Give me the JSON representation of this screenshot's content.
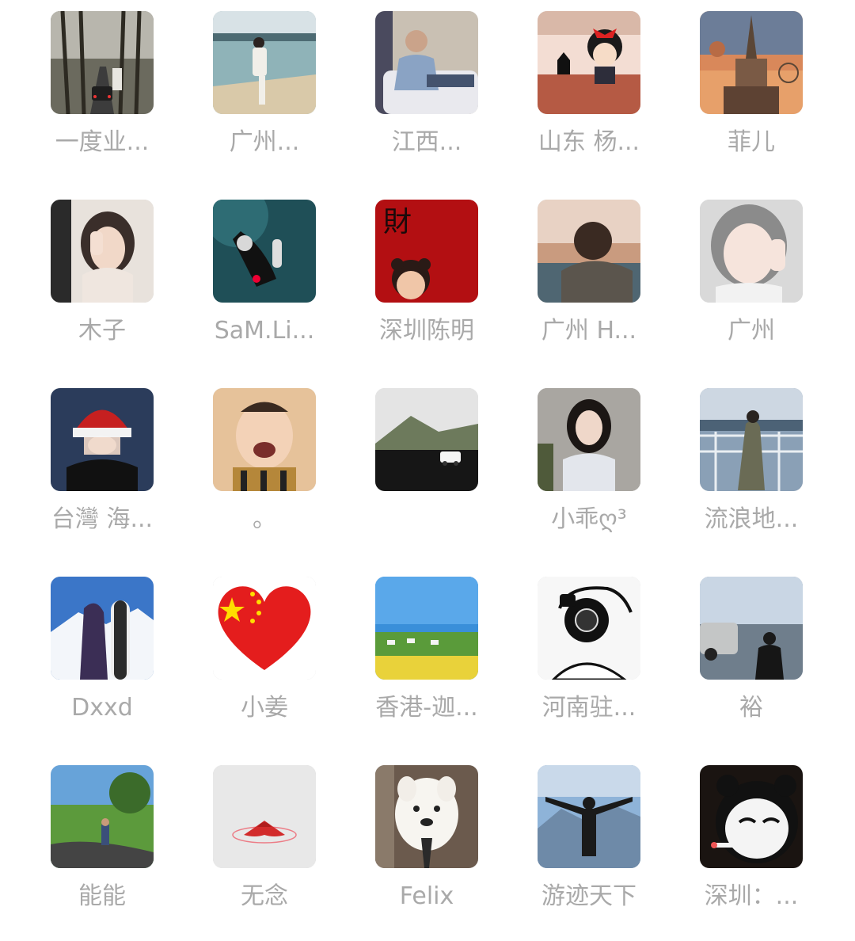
{
  "members": [
    {
      "name": "一度业...",
      "avatar": "forest-road-car-photo"
    },
    {
      "name": "广州...",
      "avatar": "man-on-beach-photo"
    },
    {
      "name": "江西...",
      "avatar": "man-sitting-on-sofa-photo"
    },
    {
      "name": "山东 杨...",
      "avatar": "cartoon-witch-girl-with-cat-image"
    },
    {
      "name": "菲儿",
      "avatar": "temple-sunset-balloon-photo"
    },
    {
      "name": "木子",
      "avatar": "girl-covering-face-photo"
    },
    {
      "name": "SaM.Li...",
      "avatar": "scuba-diver-photo"
    },
    {
      "name": "深圳陈明",
      "avatar": "cartoon-child-red-background-image"
    },
    {
      "name": "广州 H...",
      "avatar": "man-looking-at-sunset-photo"
    },
    {
      "name": "广州",
      "avatar": "smiling-girl-selfie-photo"
    },
    {
      "name": "台灣 海...",
      "avatar": "girl-with-santa-hat-photo"
    },
    {
      "name": "。",
      "avatar": "laughing-baby-photo"
    },
    {
      "name": "",
      "avatar": "white-car-black-desert-photo"
    },
    {
      "name": "小乖ღ³",
      "avatar": "long-hair-woman-photo"
    },
    {
      "name": "流浪地...",
      "avatar": "woman-by-sea-railing-photo"
    },
    {
      "name": "Dxxd",
      "avatar": "snowboarder-mountain-photo"
    },
    {
      "name": "小姜",
      "avatar": "china-flag-heart-image"
    },
    {
      "name": "香港-迦...",
      "avatar": "grassland-blue-sky-photo"
    },
    {
      "name": "河南驻...",
      "avatar": "cartoon-photographer-image"
    },
    {
      "name": "裕",
      "avatar": "man-by-car-seaside-photo"
    },
    {
      "name": "能能",
      "avatar": "child-on-park-road-photo"
    },
    {
      "name": "无念",
      "avatar": "red-lotus-image"
    },
    {
      "name": "Felix",
      "avatar": "samoyed-dog-with-tie-photo"
    },
    {
      "name": "游迹天下",
      "avatar": "man-arms-open-mountains-photo"
    },
    {
      "name": "深圳：...",
      "avatar": "cartoon-panda-smoking-image"
    }
  ],
  "colors": {
    "name_text": "#a9a9a9",
    "background": "#ffffff"
  }
}
